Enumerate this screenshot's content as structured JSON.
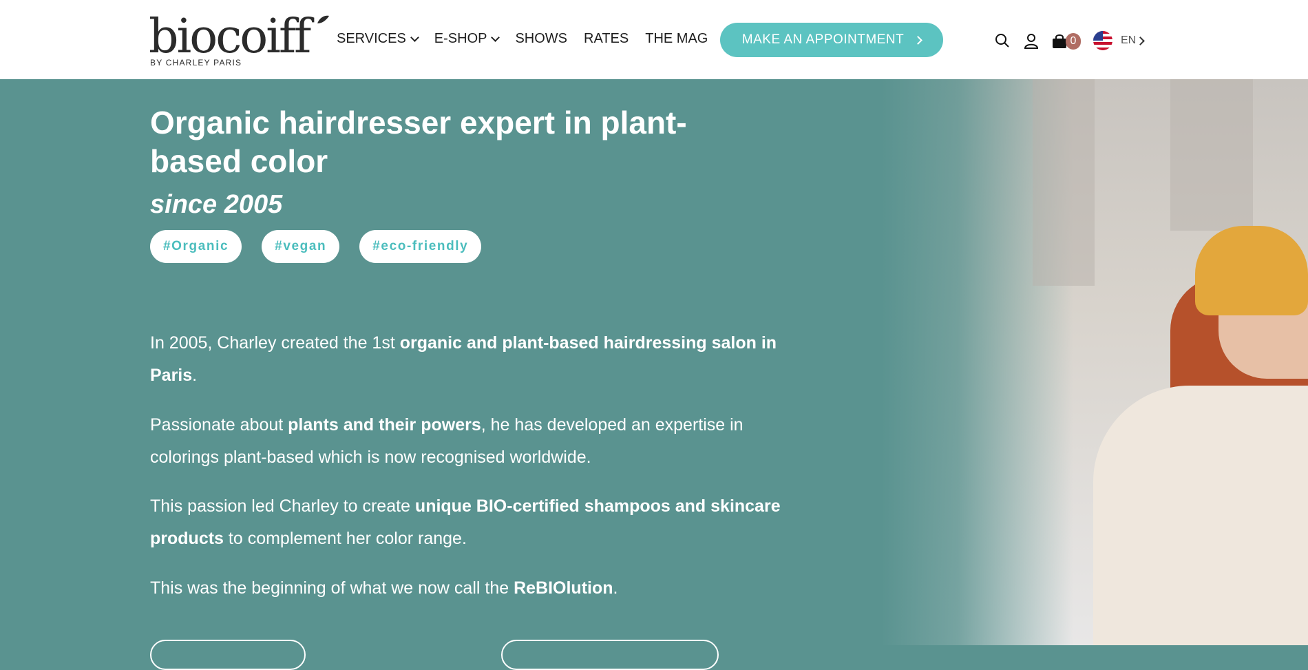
{
  "header": {
    "logo": {
      "word": "biocoiff",
      "tagline": "BY CHARLEY PARIS"
    },
    "nav": [
      {
        "label": "SERVICES",
        "has_dropdown": true
      },
      {
        "label": "E-SHOP",
        "has_dropdown": true
      },
      {
        "label": "SHOWS",
        "has_dropdown": false
      },
      {
        "label": "RATES",
        "has_dropdown": false
      },
      {
        "label": "THE MAG",
        "has_dropdown": false
      }
    ],
    "cta_label": "MAKE AN APPOINTMENT",
    "cart_count": "0",
    "language": "EN",
    "icons": [
      "search-icon",
      "user-icon",
      "bag-icon",
      "us-flag-icon"
    ]
  },
  "hero": {
    "title": "Organic hairdresser expert in plant-based color",
    "subtitle": "since 2005",
    "tags": [
      "#Organic",
      "#vegan",
      "#eco-friendly"
    ],
    "paragraphs": [
      {
        "parts": [
          {
            "text": "In 2005, Charley created the 1st ",
            "bold": false
          },
          {
            "text": "organic and plant-based hairdressing salon in Paris",
            "bold": true
          },
          {
            "text": ".",
            "bold": false
          }
        ]
      },
      {
        "parts": [
          {
            "text": "Passionate about ",
            "bold": false
          },
          {
            "text": "plants and their powers",
            "bold": true
          },
          {
            "text": ", he has developed an expertise in colorings plant-based which is now recognised worldwide.",
            "bold": false
          }
        ]
      },
      {
        "parts": [
          {
            "text": "This passion led Charley to create ",
            "bold": false
          },
          {
            "text": "unique BIO-certified shampoos and skincare products",
            "bold": true
          },
          {
            "text": " to complement her color range.",
            "bold": false
          }
        ]
      },
      {
        "parts": [
          {
            "text": "This was the beginning of what we now call the ",
            "bold": false
          },
          {
            "text": "ReBIOlution",
            "bold": true
          },
          {
            "text": ".",
            "bold": false
          }
        ]
      }
    ]
  },
  "colors": {
    "hero_bg": "#5a9390",
    "accent": "#5cc3c1",
    "tag_text": "#4bbdbd",
    "cart_badge": "#b06d64"
  }
}
